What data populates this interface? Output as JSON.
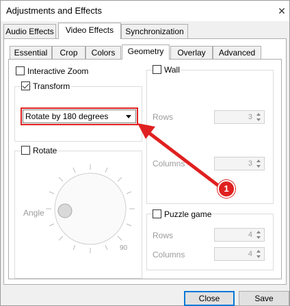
{
  "window": {
    "title": "Adjustments and Effects",
    "close_glyph": "✕"
  },
  "main_tabs": [
    {
      "label": "Audio Effects"
    },
    {
      "label": "Video Effects"
    },
    {
      "label": "Synchronization"
    }
  ],
  "sub_tabs": [
    {
      "label": "Essential"
    },
    {
      "label": "Crop"
    },
    {
      "label": "Colors"
    },
    {
      "label": "Geometry"
    },
    {
      "label": "Overlay"
    },
    {
      "label": "Advanced"
    }
  ],
  "active_main_tab": "Video Effects",
  "active_sub_tab": "Geometry",
  "geometry": {
    "interactive_zoom_label": "Interactive Zoom",
    "interactive_zoom_checked": false,
    "transform_label": "Transform",
    "transform_checked": true,
    "transform_selected": "Rotate by 180 degrees",
    "rotate_label": "Rotate",
    "rotate_checked": false,
    "angle_label": "Angle",
    "dial_tick_label": "90",
    "wall_label": "Wall",
    "wall_checked": false,
    "wall_rows_label": "Rows",
    "wall_rows_value": "3",
    "wall_columns_label": "Columns",
    "wall_columns_value": "3",
    "puzzle_label": "Puzzle game",
    "puzzle_checked": false,
    "puzzle_rows_label": "Rows",
    "puzzle_rows_value": "4",
    "puzzle_columns_label": "Columns",
    "puzzle_columns_value": "4"
  },
  "annotation": {
    "badge_number": "1",
    "color": "#e02020"
  },
  "buttons": {
    "close_label": "Close",
    "save_label": "Save"
  },
  "colors": {
    "accent": "#0078d7",
    "annotation_red": "#e02020"
  }
}
